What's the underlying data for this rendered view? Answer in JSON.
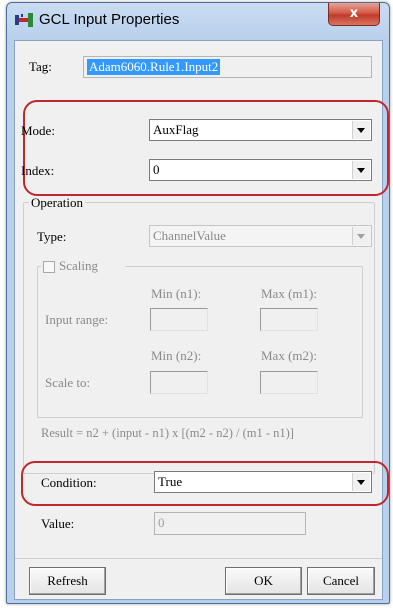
{
  "window": {
    "title": "GCL Input Properties",
    "close_label": "x"
  },
  "tag": {
    "label": "Tag:",
    "value": "Adam6060.Rule1.Input2"
  },
  "mode": {
    "label": "Mode:",
    "value": "AuxFlag"
  },
  "index": {
    "label": "Index:",
    "value": "0"
  },
  "operation": {
    "legend": "Operation",
    "type_label": "Type:",
    "type_value": "ChannelValue",
    "scaling": {
      "label": "Scaling",
      "min_n1": "Min (n1):",
      "max_m1": "Max (m1):",
      "input_range": "Input range:",
      "min_n2": "Min (n2):",
      "max_m2": "Max (m2):",
      "scale_to": "Scale to:"
    },
    "result": "Result = n2 + (input - n1) x [(m2 - n2) / (m1 - n1)]"
  },
  "condition": {
    "label": "Condition:",
    "value": "True"
  },
  "value": {
    "label": "Value:",
    "value": "0"
  },
  "buttons": {
    "refresh": "Refresh",
    "ok": "OK",
    "cancel": "Cancel"
  },
  "colors": {
    "highlight": "#c0282d",
    "selection": "#3399ff",
    "titlebar": "#b9d0ec"
  }
}
